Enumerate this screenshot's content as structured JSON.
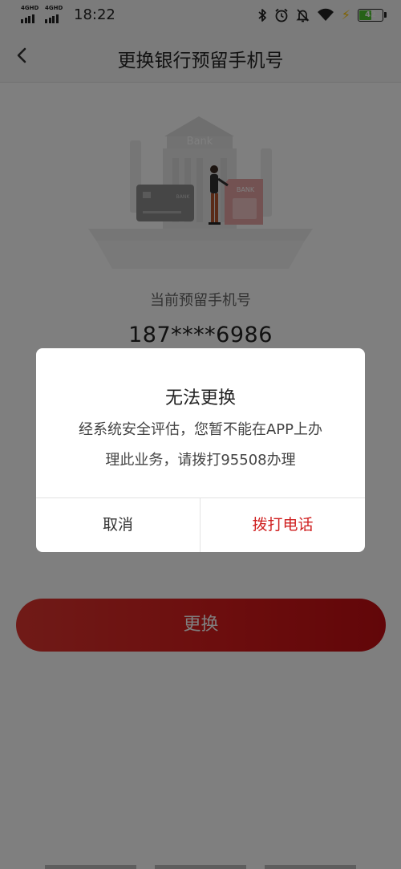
{
  "status_bar": {
    "network_1": "4GHD",
    "network_2": "4GHD",
    "time": "18:22",
    "battery": "42",
    "colors": {
      "battery_fill": "#4cc52f",
      "charging": "#ffc400"
    }
  },
  "header": {
    "back_icon": "chevron-left-icon",
    "title": "更换银行预留手机号"
  },
  "illustration": {
    "building_label": "Bank",
    "card_label": "BANK",
    "sim_label": "BANK"
  },
  "current": {
    "label": "当前预留手机号",
    "phone": "187****6986"
  },
  "change_button": {
    "label": "更换",
    "color": "#d91c1c"
  },
  "dialog": {
    "title": "无法更换",
    "message_line1": "经系统安全评估，您暂不能在APP上办",
    "message_line2": "理此业务，请拨打95508办理",
    "cancel_label": "取消",
    "call_label": "拨打电话",
    "accent_color": "#cf2020"
  }
}
